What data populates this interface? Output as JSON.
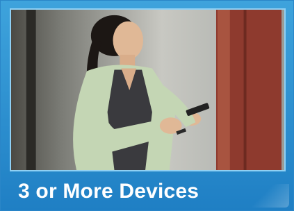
{
  "tile": {
    "caption": "3 or More Devices",
    "photo_subject": "woman-using-mobile-phone"
  },
  "colors": {
    "frame": "#2a8fd2",
    "caption_text": "#ffffff"
  }
}
